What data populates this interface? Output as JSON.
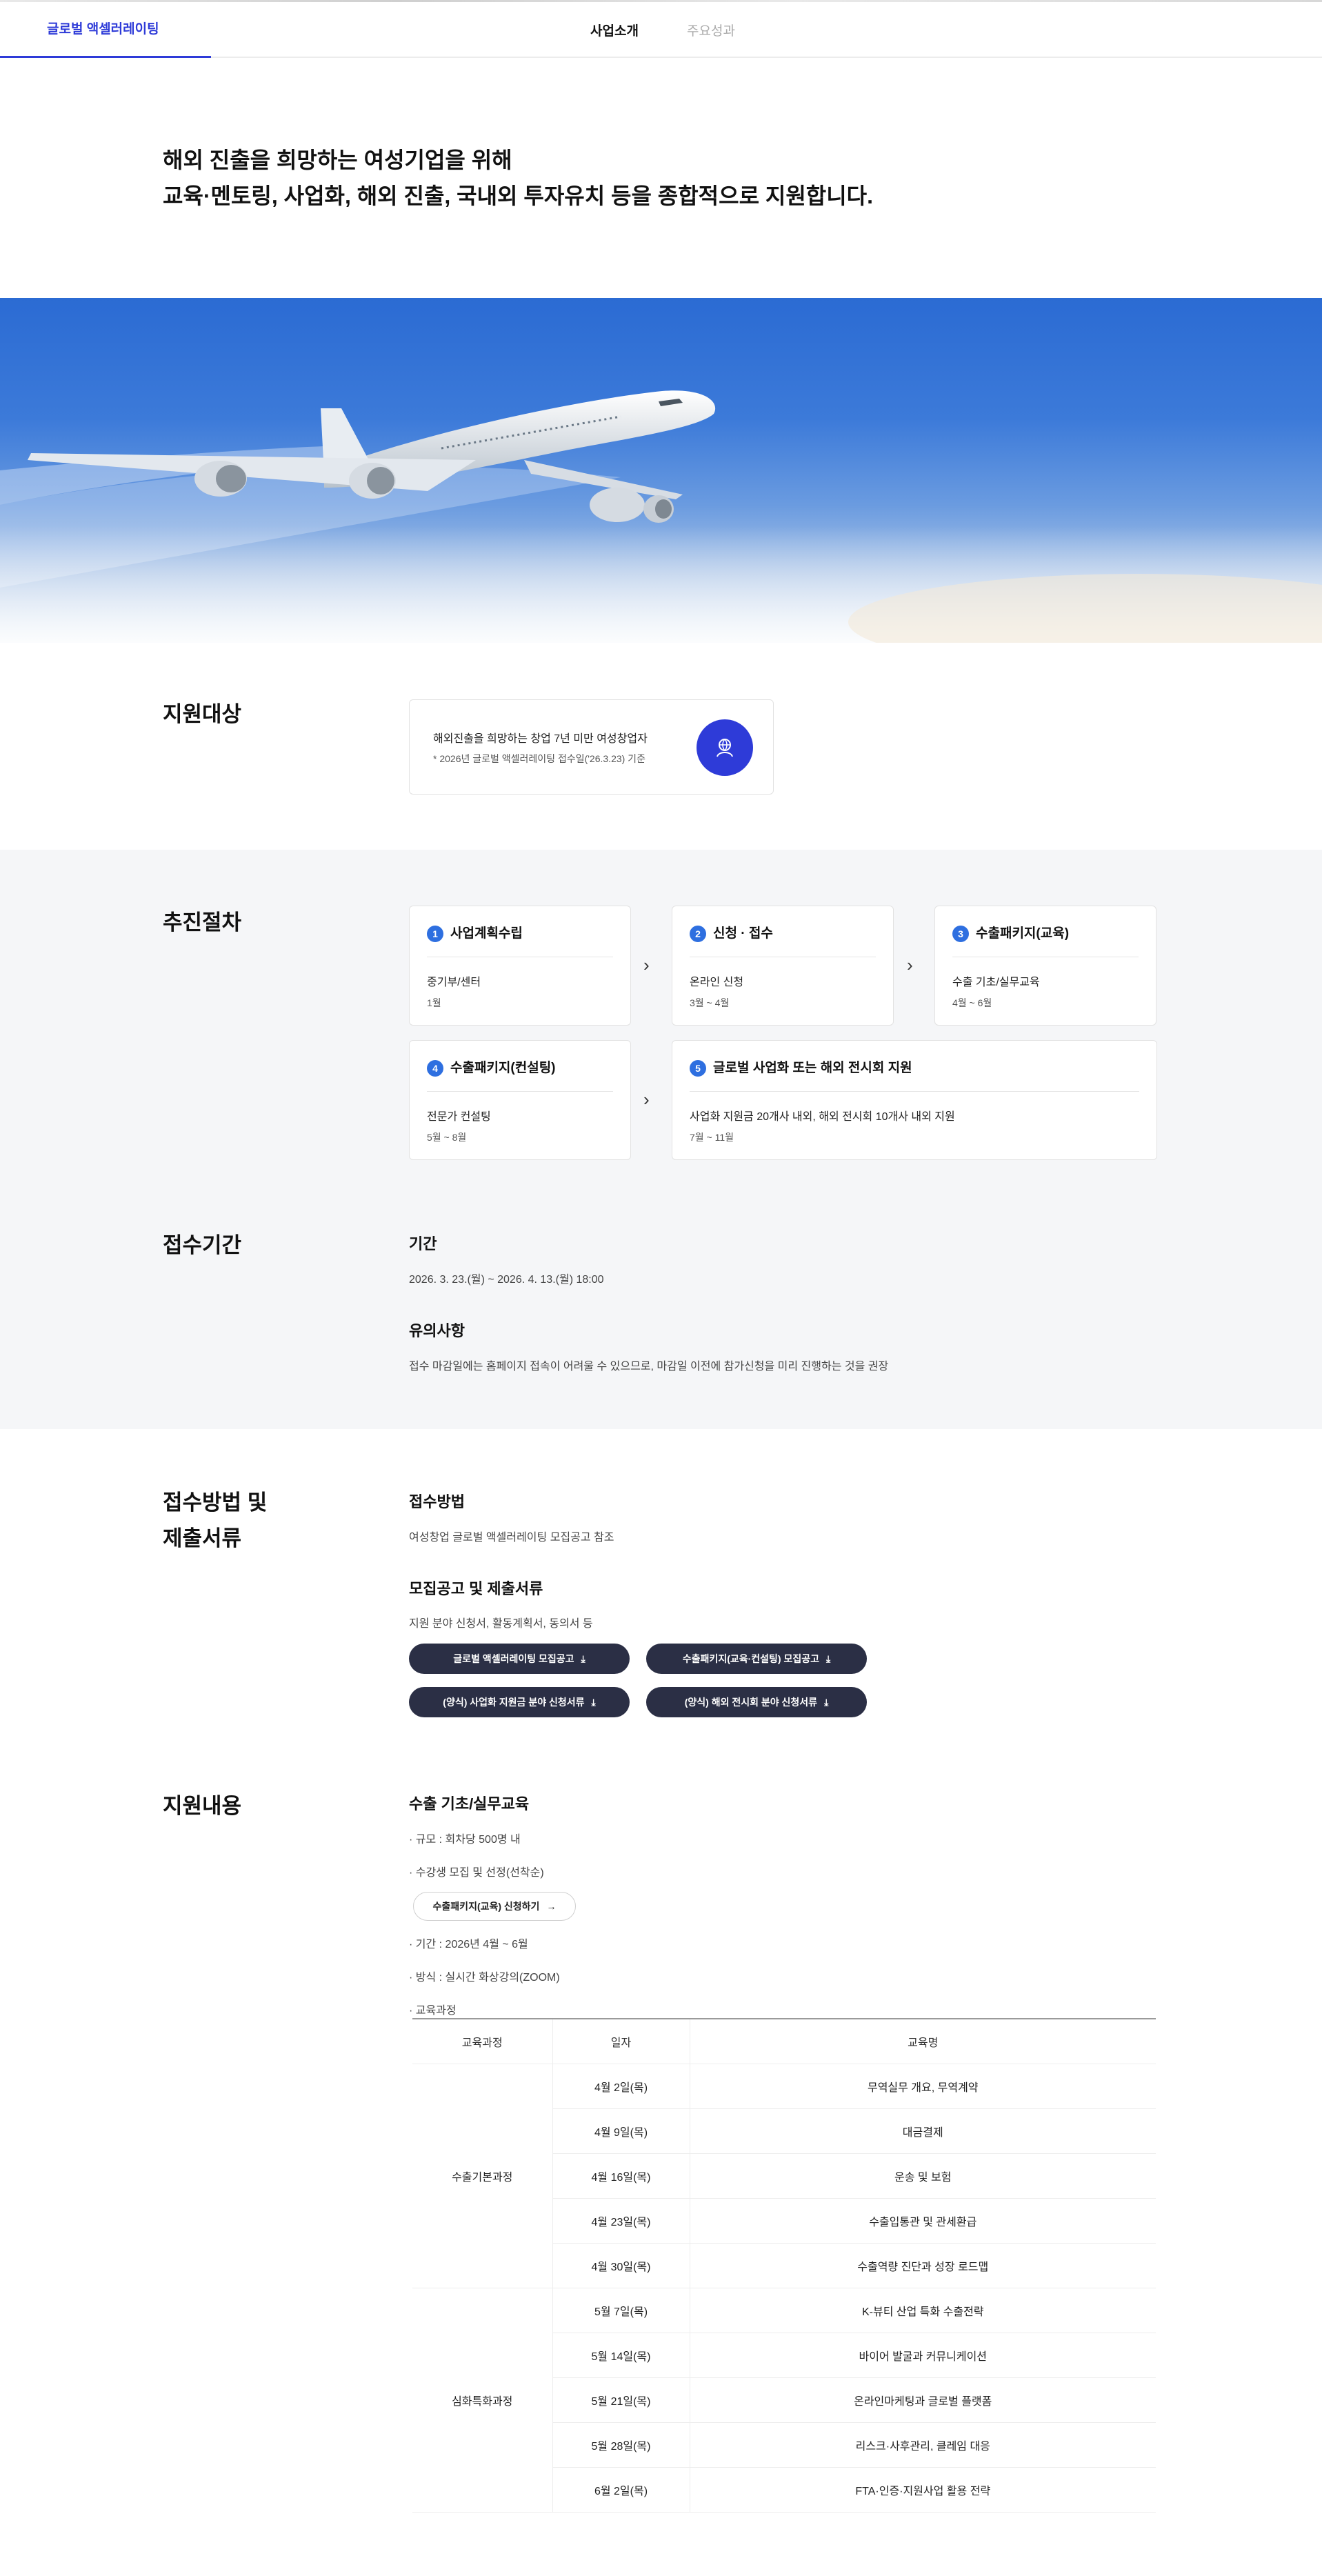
{
  "nav": {
    "brand": "글로벌 액셀러레이팅",
    "items": [
      "사업소개",
      "주요성과"
    ]
  },
  "intro": {
    "line1": "해외 진출을 희망하는 여성기업을 위해",
    "line2": "교육·멘토링, 사업화, 해외 진출, 국내외 투자유치 등을 종합적으로 지원합니다."
  },
  "target": {
    "title": "지원대상",
    "line1": "해외진출을 희망하는 창업 7년 미만 여성창업자",
    "line2": "* 2026년 글로벌 액셀러레이팅 접수일('26.3.23) 기준",
    "icon": "person-globe-icon"
  },
  "process": {
    "title": "추진절차",
    "steps": [
      {
        "num": "1",
        "title": "사업계획수립",
        "d1": "중기부/센터",
        "d2": "1월"
      },
      {
        "num": "2",
        "title": "신청 · 접수",
        "d1": "온라인 신청",
        "d2": "3월 ~ 4월"
      },
      {
        "num": "3",
        "title": "수출패키지(교육)",
        "d1": "수출 기초/실무교육",
        "d2": "4월 ~ 6월"
      },
      {
        "num": "4",
        "title": "수출패키지(컨설팅)",
        "d1": "전문가 컨설팅",
        "d2": "5월 ~ 8월"
      },
      {
        "num": "5",
        "title": "글로벌 사업화 또는 해외 전시회 지원",
        "d1": "사업화 지원금 20개사 내외, 해외 전시회 10개사 내외 지원",
        "d2": "7월 ~ 11월"
      }
    ]
  },
  "period": {
    "title": "접수기간",
    "label": "기간",
    "value": "2026. 3. 23.(월) ~ 2026. 4. 13.(월) 18:00",
    "notice_label": "유의사항",
    "notice": "접수 마감일에는 홈페이지 접속이 어려울 수 있으므로, 마감일 이전에 참가신청을 미리 진행하는 것을 권장"
  },
  "method": {
    "title1": "접수방법 및",
    "title2": "제출서류",
    "how_label": "접수방법",
    "how": "여성창업 글로벌 액셀러레이팅 모집공고 참조",
    "docs_label": "모집공고 및 제출서류",
    "docs": "지원 분야 신청서, 활동계획서, 동의서 등",
    "buttons": [
      "글로벌 액셀러레이팅 모집공고",
      "수출패키지(교육·컨설팅) 모집공고",
      "(양식) 사업화 지원금 분야 신청서류",
      "(양식) 해외 전시회 분야 신청서류"
    ]
  },
  "content": {
    "title": "지원내용",
    "sub": "수출 기초/실무교육",
    "b1": "· 규모 : 회차당 500명 내",
    "b2": "· 수강생 모집 및 선정(선착순)",
    "apply_btn": "수출패키지(교육) 신청하기",
    "b3": "· 기간 : 2026년 4월 ~ 6월",
    "b4": "· 방식 : 실시간 화상강의(ZOOM)",
    "b5": "· 교육과정",
    "table": {
      "headers": [
        "교육과정",
        "일자",
        "교육명"
      ],
      "groups": [
        {
          "course": "수출기본과정",
          "rows": [
            [
              "4월 2일(목)",
              "무역실무 개요,  무역계약"
            ],
            [
              "4월 9일(목)",
              "대금결제"
            ],
            [
              "4월 16일(목)",
              "운송 및 보험"
            ],
            [
              "4월 23일(목)",
              "수출입통관 및 관세환급"
            ],
            [
              "4월 30일(목)",
              "수출역량 진단과 성장 로드맵"
            ]
          ]
        },
        {
          "course": "심화특화과정",
          "rows": [
            [
              "5월 7일(목)",
              "K-뷰티 산업 특화 수출전략"
            ],
            [
              "5월 14일(목)",
              "바이어 발굴과 커뮤니케이션"
            ],
            [
              "5월 21일(목)",
              "온라인마케팅과 글로벌 플랫폼"
            ],
            [
              "5월 28일(목)",
              "리스크·사후관리,   클레임 대응"
            ],
            [
              "6월 2일(목)",
              "FTA·인증·지원사업 활용 전략"
            ]
          ]
        }
      ]
    }
  },
  "colors": {
    "accent": "#2e3bd8",
    "step_badge": "#2e6fe0",
    "dark_button": "#2b2f45",
    "band": "#f5f6f8"
  }
}
